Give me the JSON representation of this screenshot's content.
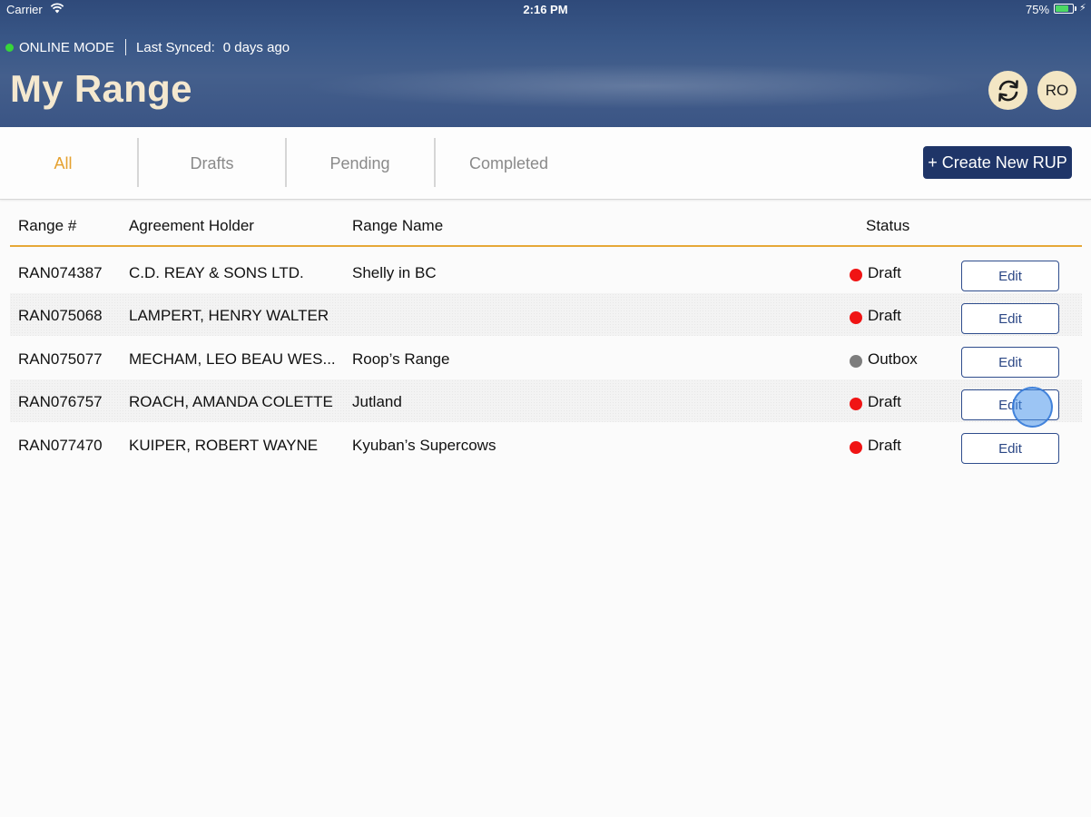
{
  "status_bar": {
    "carrier": "Carrier",
    "time": "2:16 PM",
    "battery": "75%",
    "battery_level": 0.75,
    "battery_color": "#4cd964"
  },
  "connection": {
    "mode": "ONLINE MODE",
    "mode_color": "#37d63a",
    "last_synced_label": "Last Synced:",
    "last_synced_value": "0 days ago"
  },
  "header": {
    "title": "My Range",
    "sync_icon": "refresh-icon",
    "user_initials": "RO"
  },
  "tabs": [
    {
      "label": "All",
      "active": true
    },
    {
      "label": "Drafts",
      "active": false
    },
    {
      "label": "Pending",
      "active": false
    },
    {
      "label": "Completed",
      "active": false
    }
  ],
  "create_button": "+ Create New RUP",
  "table": {
    "columns": {
      "range_number": "Range #",
      "agreement_holder": "Agreement Holder",
      "range_name": "Range Name",
      "status": "Status"
    },
    "rows": [
      {
        "range_number": "RAN074387",
        "agreement_holder": "C.D. REAY & SONS LTD.",
        "range_name": "Shelly in BC",
        "status": "Draft",
        "status_color": "#f01414",
        "action": "Edit"
      },
      {
        "range_number": "RAN075068",
        "agreement_holder": "LAMPERT, HENRY WALTER",
        "range_name": "",
        "status": "Draft",
        "status_color": "#f01414",
        "action": "Edit"
      },
      {
        "range_number": "RAN075077",
        "agreement_holder": "MECHAM, LEO BEAU WES...",
        "range_name": "Roop’s Range",
        "status": "Outbox",
        "status_color": "#7d7d7d",
        "action": "Edit"
      },
      {
        "range_number": "RAN076757",
        "agreement_holder": "ROACH, AMANDA COLETTE",
        "range_name": "Jutland",
        "status": "Draft",
        "status_color": "#f01414",
        "action": "Edit"
      },
      {
        "range_number": "RAN077470",
        "agreement_holder": "KUIPER, ROBERT WAYNE",
        "range_name": "Kyuban’s Supercows",
        "status": "Draft",
        "status_color": "#f01414",
        "action": "Edit"
      }
    ]
  },
  "colors": {
    "header_bg": "#3a5888",
    "title": "#f4e8cf",
    "accent": "#e5a12f",
    "primary_button": "#1f3568",
    "draft_status": "#f01414",
    "outbox_status": "#7d7d7d"
  }
}
